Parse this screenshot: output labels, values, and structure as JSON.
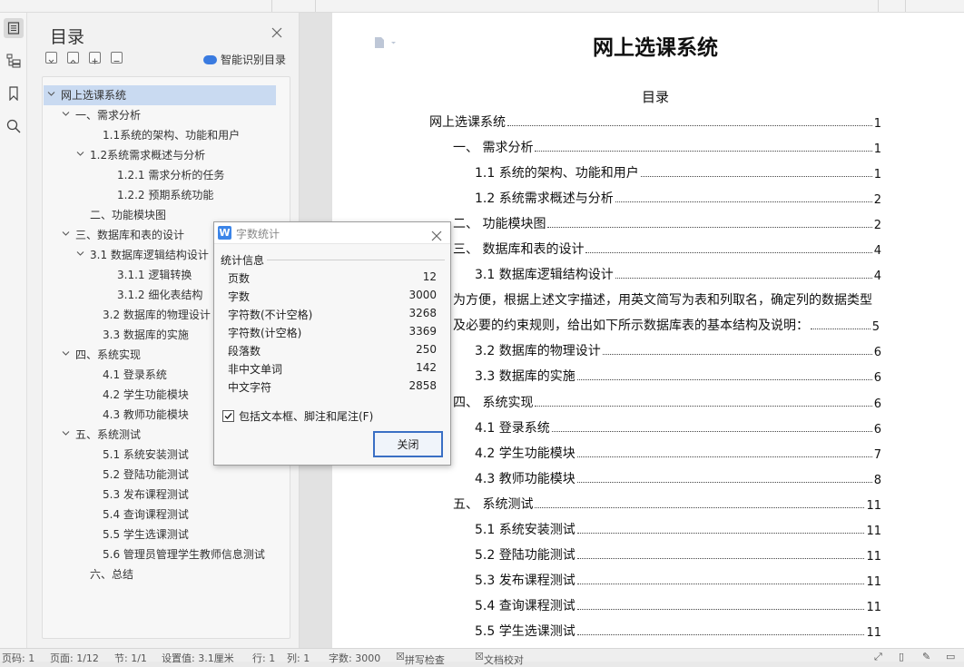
{
  "nav": {
    "title": "目录",
    "smart_label": "智能识别目录",
    "items": [
      {
        "label": "网上选课系统",
        "chev": true
      },
      {
        "label": "一、需求分析",
        "chev": true
      },
      {
        "label": "1.1系统的架构、功能和用户",
        "chev": false
      },
      {
        "label": "1.2系统需求概述与分析",
        "chev": true
      },
      {
        "label": "1.2.1 需求分析的任务",
        "chev": false
      },
      {
        "label": "1.2.2 预期系统功能",
        "chev": false
      },
      {
        "label": "二、功能模块图",
        "chev": false
      },
      {
        "label": "三、数据库和表的设计",
        "chev": true
      },
      {
        "label": "3.1 数据库逻辑结构设计",
        "chev": true
      },
      {
        "label": "3.1.1 逻辑转换",
        "chev": false
      },
      {
        "label": "3.1.2  细化表结构",
        "chev": false
      },
      {
        "label": "3.2  数据库的物理设计",
        "chev": false
      },
      {
        "label": "3.3 数据库的实施",
        "chev": false
      },
      {
        "label": "四、系统实现",
        "chev": true
      },
      {
        "label": "4.1  登录系统",
        "chev": false
      },
      {
        "label": "4.2 学生功能模块",
        "chev": false
      },
      {
        "label": "4.3 教师功能模块",
        "chev": false
      },
      {
        "label": "五、系统测试",
        "chev": true
      },
      {
        "label": "5.1  系统安装测试",
        "chev": false
      },
      {
        "label": "5.2  登陆功能测试",
        "chev": false
      },
      {
        "label": "5.3  发布课程测试",
        "chev": false
      },
      {
        "label": "5.4  查询课程测试",
        "chev": false
      },
      {
        "label": "5.5  学生选课测试",
        "chev": false
      },
      {
        "label": "5.6  管理员管理学生教师信息测试",
        "chev": false
      },
      {
        "label": "六、总结",
        "chev": false
      }
    ]
  },
  "dialog": {
    "title": "字数统计",
    "group": "统计信息",
    "stats": [
      {
        "label": "页数",
        "value": "12"
      },
      {
        "label": "字数",
        "value": "3000"
      },
      {
        "label": "字符数(不计空格)",
        "value": "3268"
      },
      {
        "label": "字符数(计空格)",
        "value": "3369"
      },
      {
        "label": "段落数",
        "value": "250"
      },
      {
        "label": "非中文单词",
        "value": "142"
      },
      {
        "label": "中文字符",
        "value": "2858"
      }
    ],
    "checkbox_label": "包括文本框、脚注和尾注(F)",
    "checkbox_checked": true,
    "close_label": "关闭"
  },
  "doc": {
    "title": "网上选课系统",
    "toc_heading": "目录",
    "toc": [
      {
        "text": "网上选课系统",
        "page": "1"
      },
      {
        "text": "一、  需求分析",
        "page": "1"
      },
      {
        "text": "1.1  系统的架构、功能和用户",
        "page": "1"
      },
      {
        "text": "1.2  系统需求概述与分析",
        "page": "2"
      },
      {
        "text": "二、  功能模块图",
        "page": "2"
      },
      {
        "text": "三、  数据库和表的设计",
        "page": "4"
      },
      {
        "text": "3.1 数据库逻辑结构设计",
        "page": "4"
      },
      {
        "text": "3.2 数据库的物理设计",
        "page": "6"
      },
      {
        "text": "3.3 数据库的实施",
        "page": "6"
      },
      {
        "text": "四、  系统实现",
        "page": "6"
      },
      {
        "text": "4.1  登录系统",
        "page": "6"
      },
      {
        "text": "4.2 学生功能模块",
        "page": "7"
      },
      {
        "text": "4.3 教师功能模块",
        "page": "8"
      },
      {
        "text": "五、  系统测试",
        "page": "11"
      },
      {
        "text": "5.1  系统安装测试",
        "page": "11"
      },
      {
        "text": "5.2  登陆功能测试",
        "page": "11"
      },
      {
        "text": "5.3  发布课程测试",
        "page": "11"
      },
      {
        "text": "5.4  查询课程测试",
        "page": "11"
      },
      {
        "text": "5.5  学生选课测试",
        "page": "11"
      }
    ],
    "para_line1": "为方便，根据上述文字描述，用英文简写为表和列取名，确定列的数据类型",
    "para_line2": "及必要的约束规则，给出如下所示数据库表的基本结构及说明：",
    "para_page": "5"
  },
  "status": {
    "page_code": "页码: 1",
    "page": "页面: 1/12",
    "section": "节: 1/1",
    "position": "设置值: 3.1厘米",
    "row": "行: 1",
    "col": "列: 1",
    "words": "字数: 3000",
    "spell": "拼写检查",
    "proof": "文档校对"
  },
  "colors": {
    "accent": "#3a7be0",
    "selection": "#c9daf1"
  }
}
